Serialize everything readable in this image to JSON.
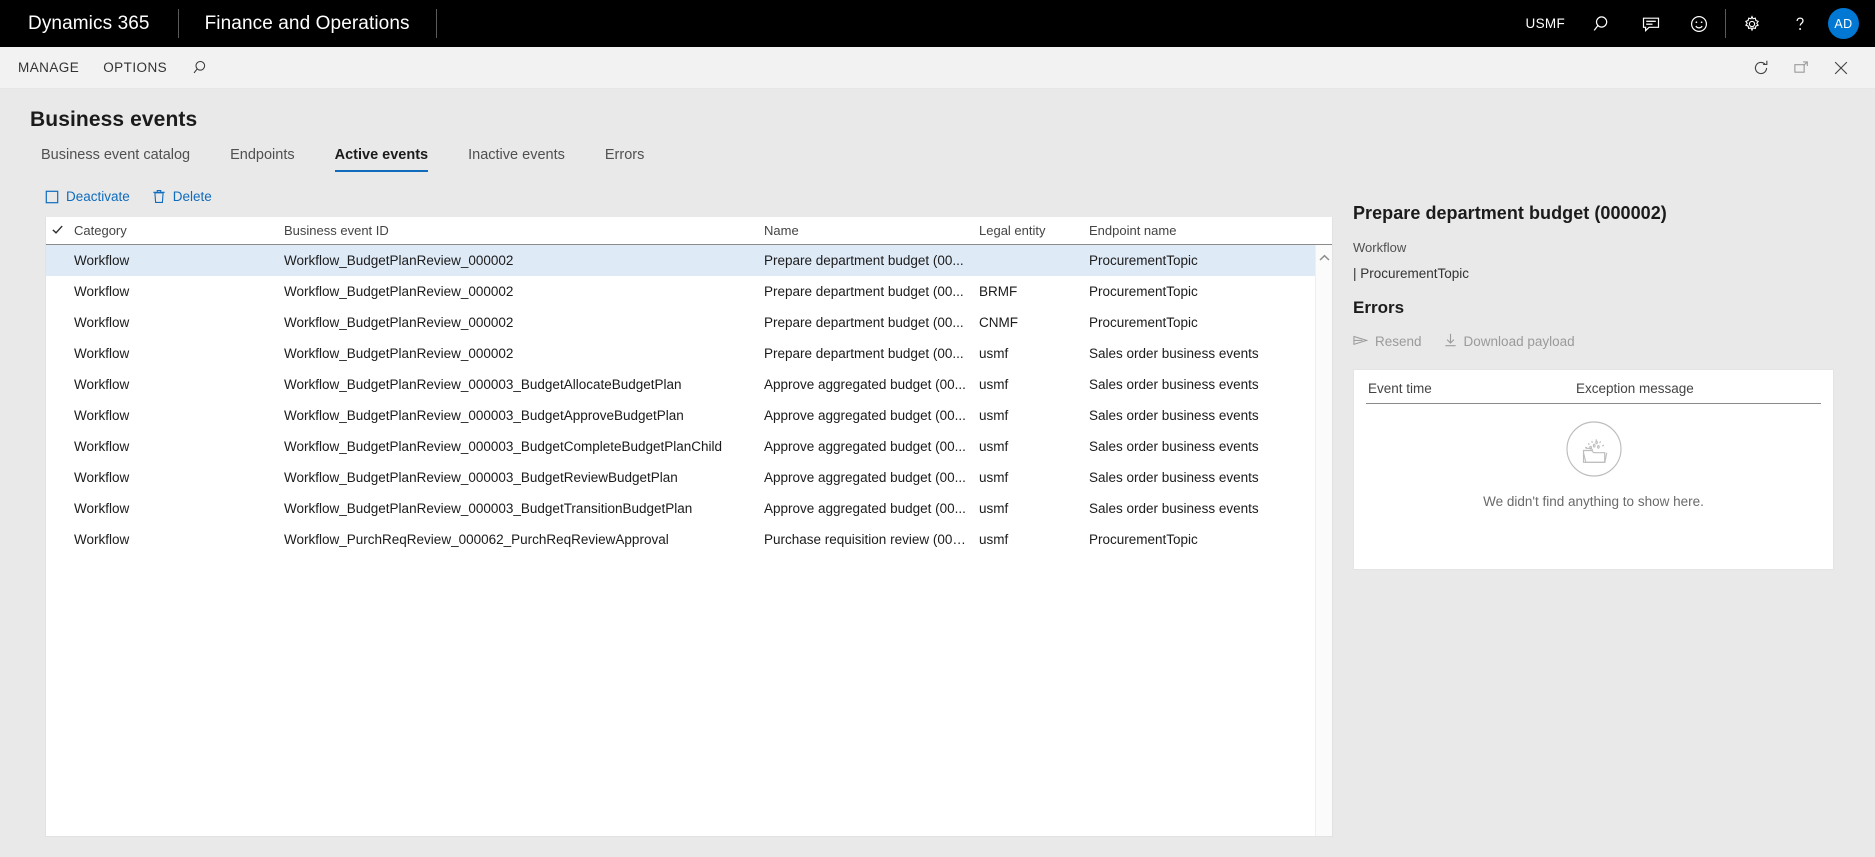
{
  "topbar": {
    "brand": "Dynamics 365",
    "module": "Finance and Operations",
    "company": "USMF",
    "avatar_initials": "AD",
    "icons": [
      "search-icon",
      "feedback-icon",
      "smiley-icon",
      "gear-icon",
      "help-icon"
    ]
  },
  "actionbar": {
    "items": [
      "MANAGE",
      "OPTIONS"
    ],
    "search_icon": "search-icon",
    "right_icons": [
      "refresh-icon",
      "popout-icon",
      "close-icon"
    ]
  },
  "page": {
    "title": "Business events",
    "tabs": [
      {
        "label": "Business event catalog",
        "active": false
      },
      {
        "label": "Endpoints",
        "active": false
      },
      {
        "label": "Active events",
        "active": true
      },
      {
        "label": "Inactive events",
        "active": false
      },
      {
        "label": "Errors",
        "active": false
      }
    ]
  },
  "grid_toolbar": {
    "deactivate_label": "Deactivate",
    "delete_label": "Delete"
  },
  "grid": {
    "columns": [
      "Category",
      "Business event ID",
      "Name",
      "Legal entity",
      "Endpoint name"
    ],
    "rows": [
      {
        "category": "Workflow",
        "business_event_id": "Workflow_BudgetPlanReview_000002",
        "name": "Prepare department budget (00...",
        "legal_entity": "",
        "endpoint_name": "ProcurementTopic",
        "selected": true
      },
      {
        "category": "Workflow",
        "business_event_id": "Workflow_BudgetPlanReview_000002",
        "name": "Prepare department budget (00...",
        "legal_entity": "BRMF",
        "endpoint_name": "ProcurementTopic",
        "selected": false
      },
      {
        "category": "Workflow",
        "business_event_id": "Workflow_BudgetPlanReview_000002",
        "name": "Prepare department budget (00...",
        "legal_entity": "CNMF",
        "endpoint_name": "ProcurementTopic",
        "selected": false
      },
      {
        "category": "Workflow",
        "business_event_id": "Workflow_BudgetPlanReview_000002",
        "name": "Prepare department budget (00...",
        "legal_entity": "usmf",
        "endpoint_name": "Sales order business events",
        "selected": false
      },
      {
        "category": "Workflow",
        "business_event_id": "Workflow_BudgetPlanReview_000003_BudgetAllocateBudgetPlan",
        "name": "Approve aggregated budget (00...",
        "legal_entity": "usmf",
        "endpoint_name": "Sales order business events",
        "selected": false
      },
      {
        "category": "Workflow",
        "business_event_id": "Workflow_BudgetPlanReview_000003_BudgetApproveBudgetPlan",
        "name": "Approve aggregated budget (00...",
        "legal_entity": "usmf",
        "endpoint_name": "Sales order business events",
        "selected": false
      },
      {
        "category": "Workflow",
        "business_event_id": "Workflow_BudgetPlanReview_000003_BudgetCompleteBudgetPlanChild",
        "name": "Approve aggregated budget (00...",
        "legal_entity": "usmf",
        "endpoint_name": "Sales order business events",
        "selected": false
      },
      {
        "category": "Workflow",
        "business_event_id": "Workflow_BudgetPlanReview_000003_BudgetReviewBudgetPlan",
        "name": "Approve aggregated budget (00...",
        "legal_entity": "usmf",
        "endpoint_name": "Sales order business events",
        "selected": false
      },
      {
        "category": "Workflow",
        "business_event_id": "Workflow_BudgetPlanReview_000003_BudgetTransitionBudgetPlan",
        "name": "Approve aggregated budget (00...",
        "legal_entity": "usmf",
        "endpoint_name": "Sales order business events",
        "selected": false
      },
      {
        "category": "Workflow",
        "business_event_id": "Workflow_PurchReqReview_000062_PurchReqReviewApproval",
        "name": "Purchase requisition review (000...",
        "legal_entity": "usmf",
        "endpoint_name": "ProcurementTopic",
        "selected": false
      }
    ]
  },
  "detail": {
    "title": "Prepare department budget (000002)",
    "subtitle": "Workflow",
    "endpoint_line": "| ProcurementTopic",
    "errors_heading": "Errors",
    "resend_label": "Resend",
    "download_label": "Download payload",
    "errors_table": {
      "columns": [
        "Event time",
        "Exception message"
      ],
      "rows": [],
      "empty_message": "We didn't find anything to show here."
    }
  },
  "colors": {
    "accent": "#0f6cbd",
    "topbar_bg": "#000000",
    "page_bg": "#e9e9e9",
    "selected_row": "#dfeaf7",
    "avatar_bg": "#0078d4"
  }
}
